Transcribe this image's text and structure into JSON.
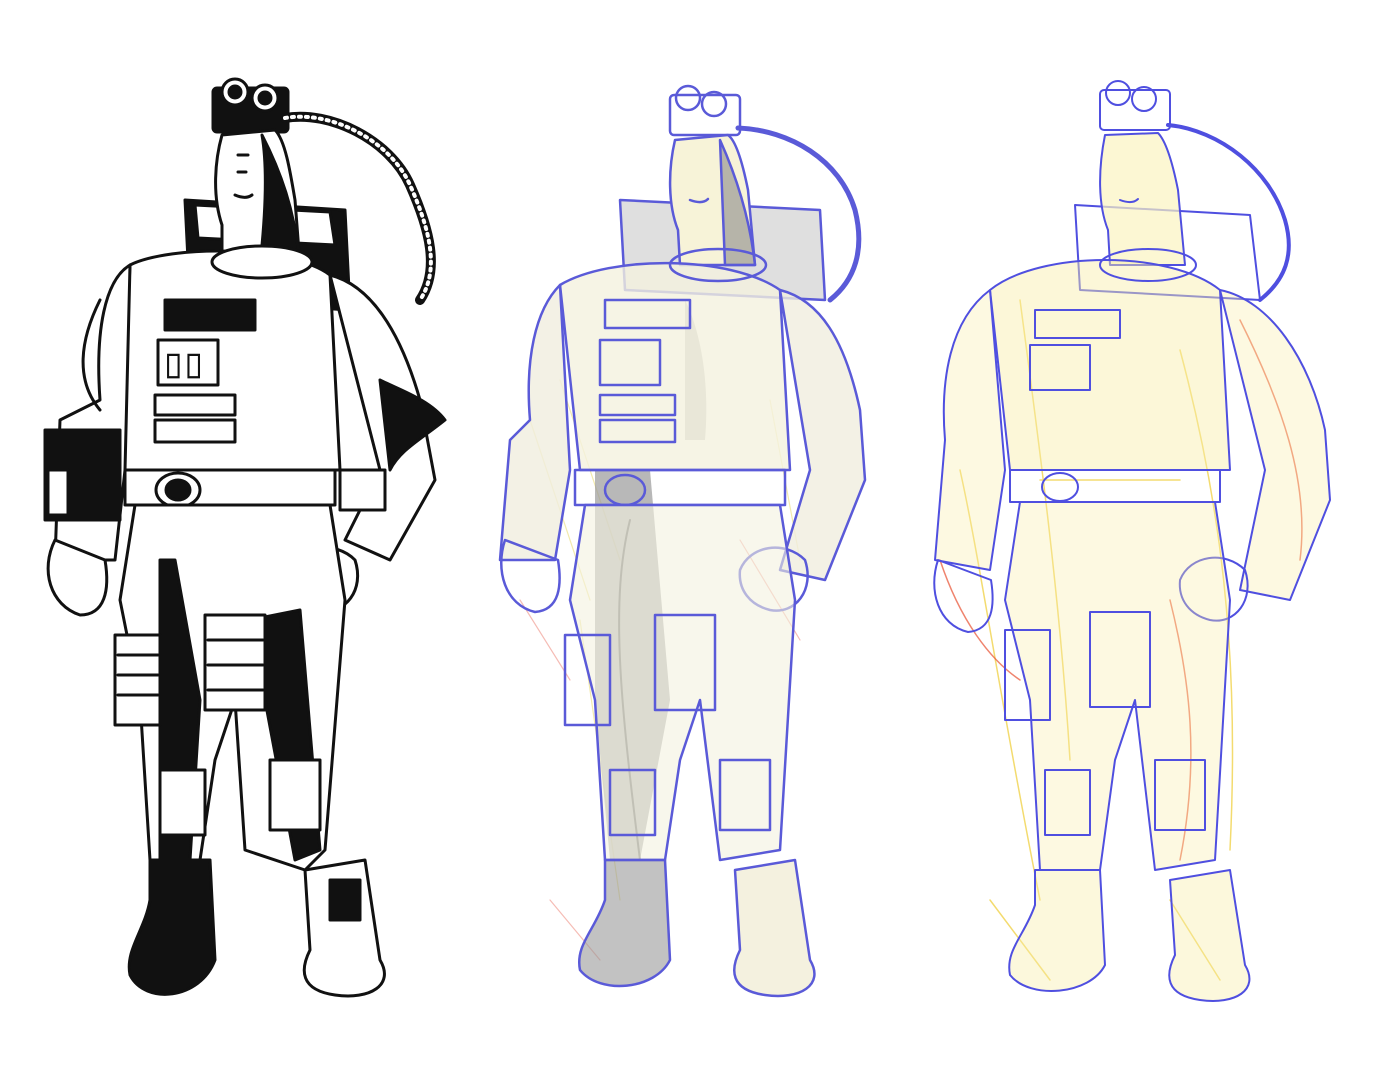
{
  "figure": {
    "panels": [
      {
        "id": "ink",
        "stage": "final-ink",
        "palette": {
          "line": "#111111",
          "fill": "#ffffff"
        }
      },
      {
        "id": "sketch",
        "stage": "shaded-pencil",
        "palette": {
          "line": "#5a5ad8",
          "shade": "#8a8a8a",
          "accent1": "#e8d96a",
          "accent2": "#e86a5a"
        }
      },
      {
        "id": "rough",
        "stage": "construction-rough",
        "palette": {
          "line": "#4f4fe0",
          "accent1": "#f0d040",
          "accent2": "#e85030"
        }
      }
    ],
    "subject": "astronaut-character"
  }
}
